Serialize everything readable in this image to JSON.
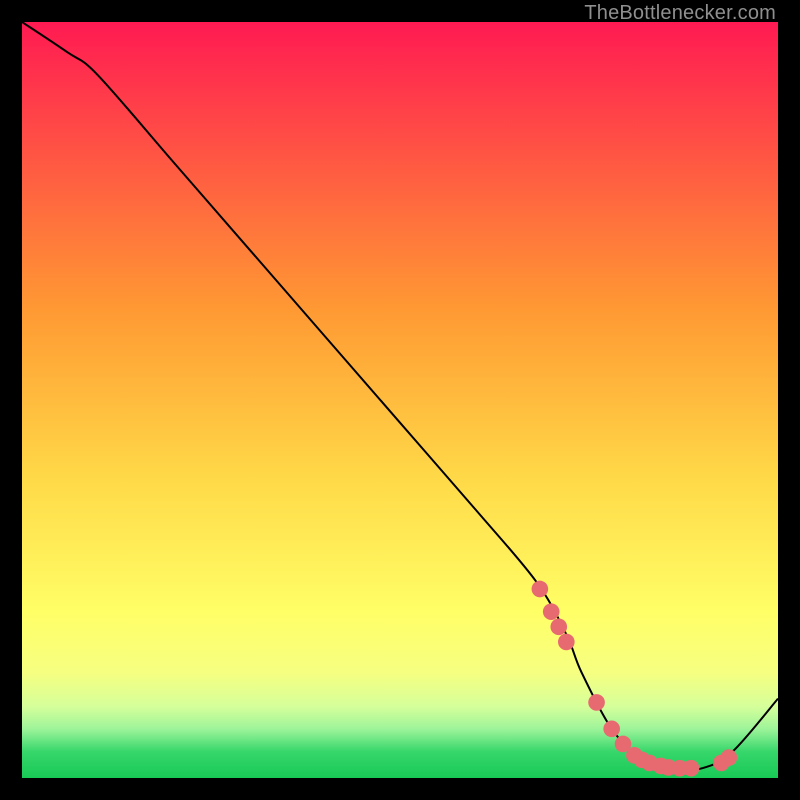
{
  "attribution": "TheBottlenecker.com",
  "colors": {
    "bg_black": "#000000",
    "band_green": "#18d158",
    "band_yellow": "#ffff66",
    "top_red": "#ff1a52",
    "mid_orange": "#ff9e36",
    "curve": "#000000",
    "marker": "#e86a71",
    "attribution_text": "#8f8f8f"
  },
  "chart_data": {
    "type": "line",
    "title": "",
    "xlabel": "",
    "ylabel": "",
    "xlim": [
      0,
      100
    ],
    "ylim": [
      0,
      100
    ],
    "curve": {
      "x": [
        0,
        6,
        10,
        20,
        30,
        40,
        50,
        60,
        68,
        72,
        74,
        78,
        82,
        86,
        90,
        94,
        100
      ],
      "y": [
        100,
        96,
        93,
        81.5,
        70,
        58.5,
        47,
        35.5,
        26,
        19,
        14,
        6.5,
        2.5,
        1.3,
        1.3,
        3.5,
        10.5
      ]
    },
    "markers": {
      "x": [
        68.5,
        70.0,
        71.0,
        72.0,
        76.0,
        78.0,
        79.5,
        81.0,
        82.0,
        83.0,
        84.5,
        85.5,
        87.0,
        88.5,
        92.5,
        93.5
      ],
      "y": [
        25.0,
        22.0,
        20.0,
        18.0,
        10.0,
        6.5,
        4.5,
        3.0,
        2.4,
        2.0,
        1.6,
        1.4,
        1.3,
        1.3,
        2.0,
        2.7
      ]
    },
    "gradient_stops": [
      {
        "offset": 0.0,
        "color": "#ff1a52"
      },
      {
        "offset": 0.38,
        "color": "#ff9933"
      },
      {
        "offset": 0.6,
        "color": "#ffd847"
      },
      {
        "offset": 0.78,
        "color": "#ffff66"
      },
      {
        "offset": 0.86,
        "color": "#f6ff80"
      },
      {
        "offset": 0.905,
        "color": "#d6ff9a"
      },
      {
        "offset": 0.935,
        "color": "#9ef49a"
      },
      {
        "offset": 0.965,
        "color": "#37d76b"
      },
      {
        "offset": 1.0,
        "color": "#18c956"
      }
    ]
  }
}
